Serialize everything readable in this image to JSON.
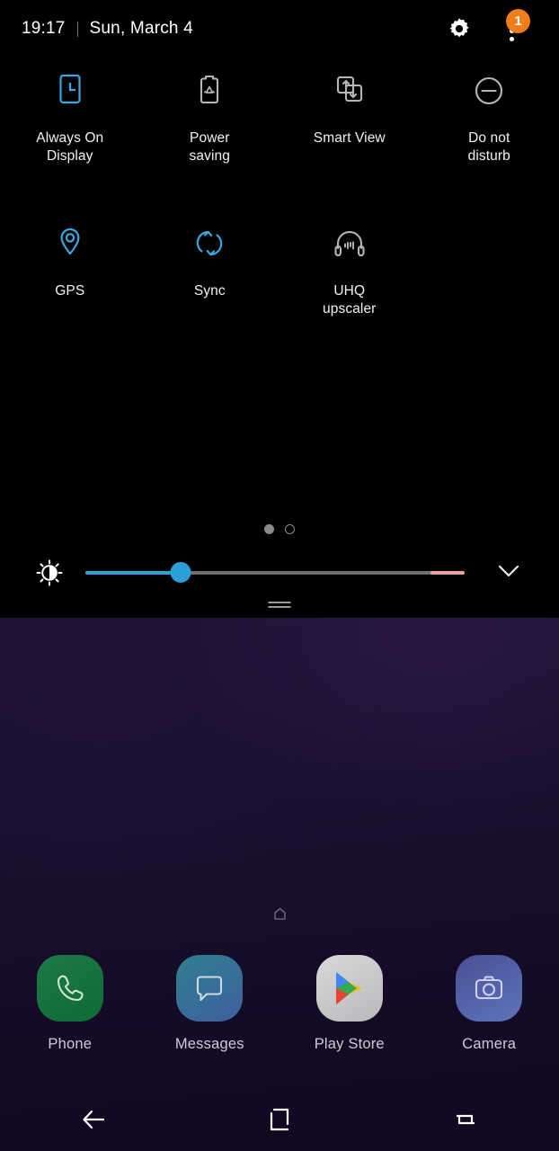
{
  "status_bar": {
    "time": "19:17",
    "date": "Sun, March 4",
    "gear_icon": "gear-icon",
    "overflow_icon": "overflow-menu-icon",
    "notification_badge": "1",
    "badge_color": "#f07d1a"
  },
  "quick_settings": {
    "toggles": [
      {
        "label": "Always On\nDisplay",
        "icon": "always-on-display-icon",
        "state": "on",
        "color": "#3aa8e0"
      },
      {
        "label": "Power\nsaving",
        "icon": "power-saving-icon",
        "state": "off",
        "color": "#b6b6b6"
      },
      {
        "label": "Smart View",
        "icon": "smart-view-icon",
        "state": "off",
        "color": "#b6b6b6"
      },
      {
        "label": "Do not\ndisturb",
        "icon": "do-not-disturb-icon",
        "state": "off",
        "color": "#b6b6b6"
      },
      {
        "label": "GPS",
        "icon": "gps-location-icon",
        "state": "on",
        "color": "#3aa8e0"
      },
      {
        "label": "Sync",
        "icon": "sync-icon",
        "state": "on",
        "color": "#3aa8e0"
      },
      {
        "label": "UHQ\nupscaler",
        "icon": "uhq-upscaler-icon",
        "state": "off",
        "color": "#b6b6b6"
      }
    ],
    "pagination": {
      "total": 2,
      "current": 1
    },
    "brightness": {
      "icon": "brightness-sun-icon",
      "expand_icon": "chevron-down-icon",
      "value_percent": 25,
      "hot_zone_start_percent": 91,
      "fill_color": "#2a9fd8",
      "track_color": "#6e6e6e",
      "hot_color": "#e8a0a0"
    },
    "handle": "panel-drag-handle"
  },
  "home_screen": {
    "home_indicator_icon": "home-page-indicator-icon",
    "dock": [
      {
        "label": "Phone",
        "icon": "phone-icon",
        "bg": "#156b3b"
      },
      {
        "label": "Messages",
        "icon": "messages-icon",
        "bg": "#35709a"
      },
      {
        "label": "Play Store",
        "icon": "play-store-icon",
        "bg": "#d4d4d6"
      },
      {
        "label": "Camera",
        "icon": "camera-icon",
        "bg": "#545aa4"
      }
    ]
  },
  "nav_bar": {
    "buttons": [
      {
        "name": "back",
        "icon": "back-arrow-icon"
      },
      {
        "name": "home",
        "icon": "home-square-icon"
      },
      {
        "name": "recents",
        "icon": "recents-icon"
      }
    ]
  }
}
